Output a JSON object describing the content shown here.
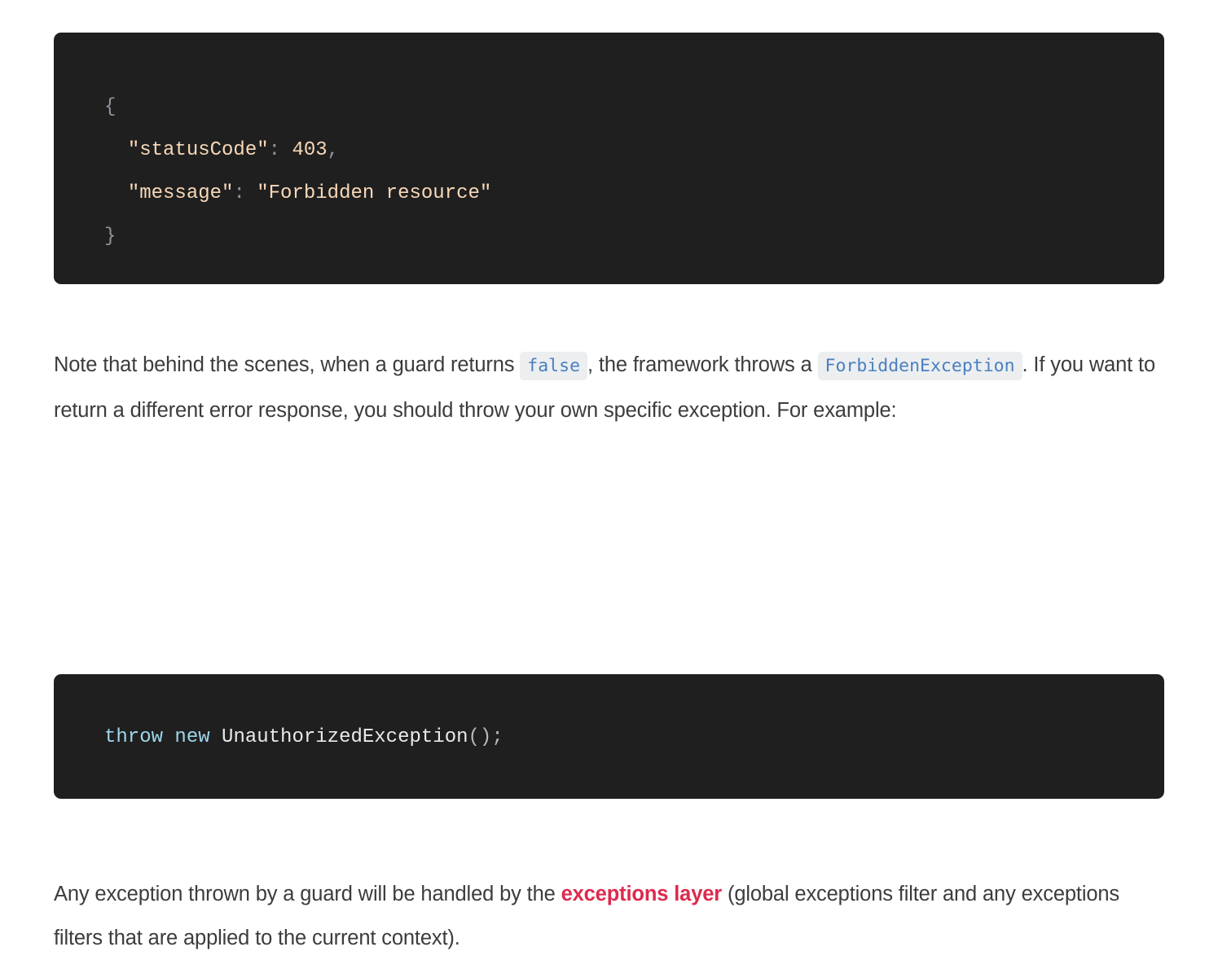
{
  "theme": {
    "page_background": "#ffffff",
    "code_background": "#1f1f1f",
    "body_text": "#3c3c3c",
    "inline_code_background": "#eceef0",
    "inline_code_text": "#4a7fc1",
    "link_accent": "#dd2a4d",
    "code_string": "#f9d8b8",
    "code_keyword": "#9ed6ea",
    "code_punctuation": "#8f959c",
    "code_identifier": "#e9e9e9"
  },
  "code_block_json": {
    "language": "json",
    "lines": [
      {
        "open_brace": "{"
      },
      {
        "key": "\"statusCode\"",
        "colon": ": ",
        "value": "403",
        "comma": ","
      },
      {
        "key": "\"message\"",
        "colon": ": ",
        "value": "\"Forbidden resource\""
      },
      {
        "close_brace": "}"
      }
    ],
    "full_text": "{\n  \"statusCode\": 403,\n  \"message\": \"Forbidden resource\"\n}"
  },
  "paragraph_note": {
    "part1": "Note that behind the scenes, when a guard returns ",
    "code1": "false",
    "part2": ", the framework throws a ",
    "code2": "ForbiddenException",
    "part3": ". If you want to return a different error response, you should throw your own specific exception. For example:"
  },
  "code_block_throw": {
    "language": "typescript",
    "keyword_throw": "throw",
    "keyword_new": "new",
    "identifier": "UnauthorizedException",
    "parens": "()",
    "semicolon": ";",
    "full_text": "throw new UnauthorizedException();"
  },
  "paragraph_final": {
    "part1": "Any exception thrown by a guard will be handled by the ",
    "link_text": "exceptions layer",
    "part2": " (global exceptions filter and any exceptions filters that are applied to the current context)."
  }
}
